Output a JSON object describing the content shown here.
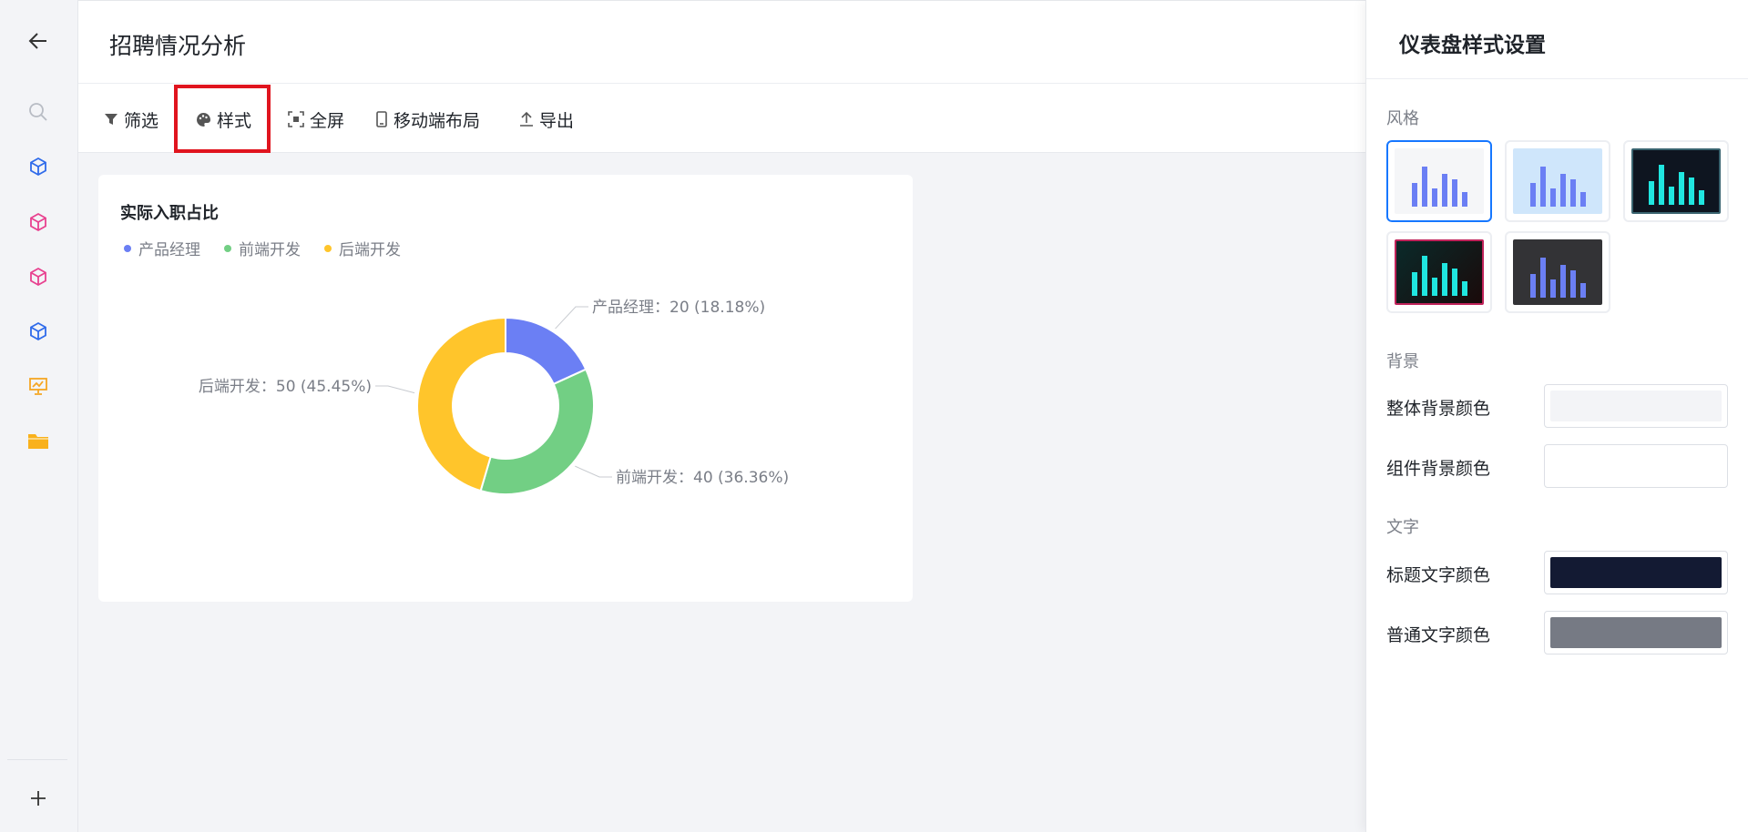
{
  "header": {
    "title": "招聘情况分析"
  },
  "toolbar": {
    "filter": "筛选",
    "style": "样式",
    "fullscreen": "全屏",
    "mobile_layout": "移动端布局",
    "export": "导出"
  },
  "rail": {
    "icons": [
      "back-arrow-icon",
      "search-icon",
      "cube-icon",
      "cube-icon",
      "cube-icon",
      "cube-icon",
      "presentation-icon",
      "folder-icon",
      "plus-icon"
    ]
  },
  "card": {
    "title": "实际入职占比",
    "legend": [
      "产品经理",
      "前端开发",
      "后端开发"
    ]
  },
  "chart_data": {
    "type": "pie",
    "donut": true,
    "title": "实际入职占比",
    "categories": [
      "产品经理",
      "前端开发",
      "后端开发"
    ],
    "values": [
      20,
      40,
      50
    ],
    "labels": [
      "产品经理：20 (18.18%)",
      "前端开发：40 (36.36%)",
      "后端开发：50 (45.45%)"
    ],
    "colors": [
      "#6b7ff4",
      "#72cf84",
      "#ffc52b"
    ],
    "legend_position": "top-left"
  },
  "panel": {
    "title": "仪表盘样式设置",
    "style_section": "风格",
    "background_section": "背景",
    "overall_bg_label": "整体背景颜色",
    "component_bg_label": "组件背景颜色",
    "text_section": "文字",
    "title_color_label": "标题文字颜色",
    "normal_color_label": "普通文字颜色",
    "colors": {
      "overall_bg": "#f3f4f7",
      "component_bg": "#ffffff",
      "title_text": "#131a33",
      "normal_text": "#767a84"
    }
  }
}
